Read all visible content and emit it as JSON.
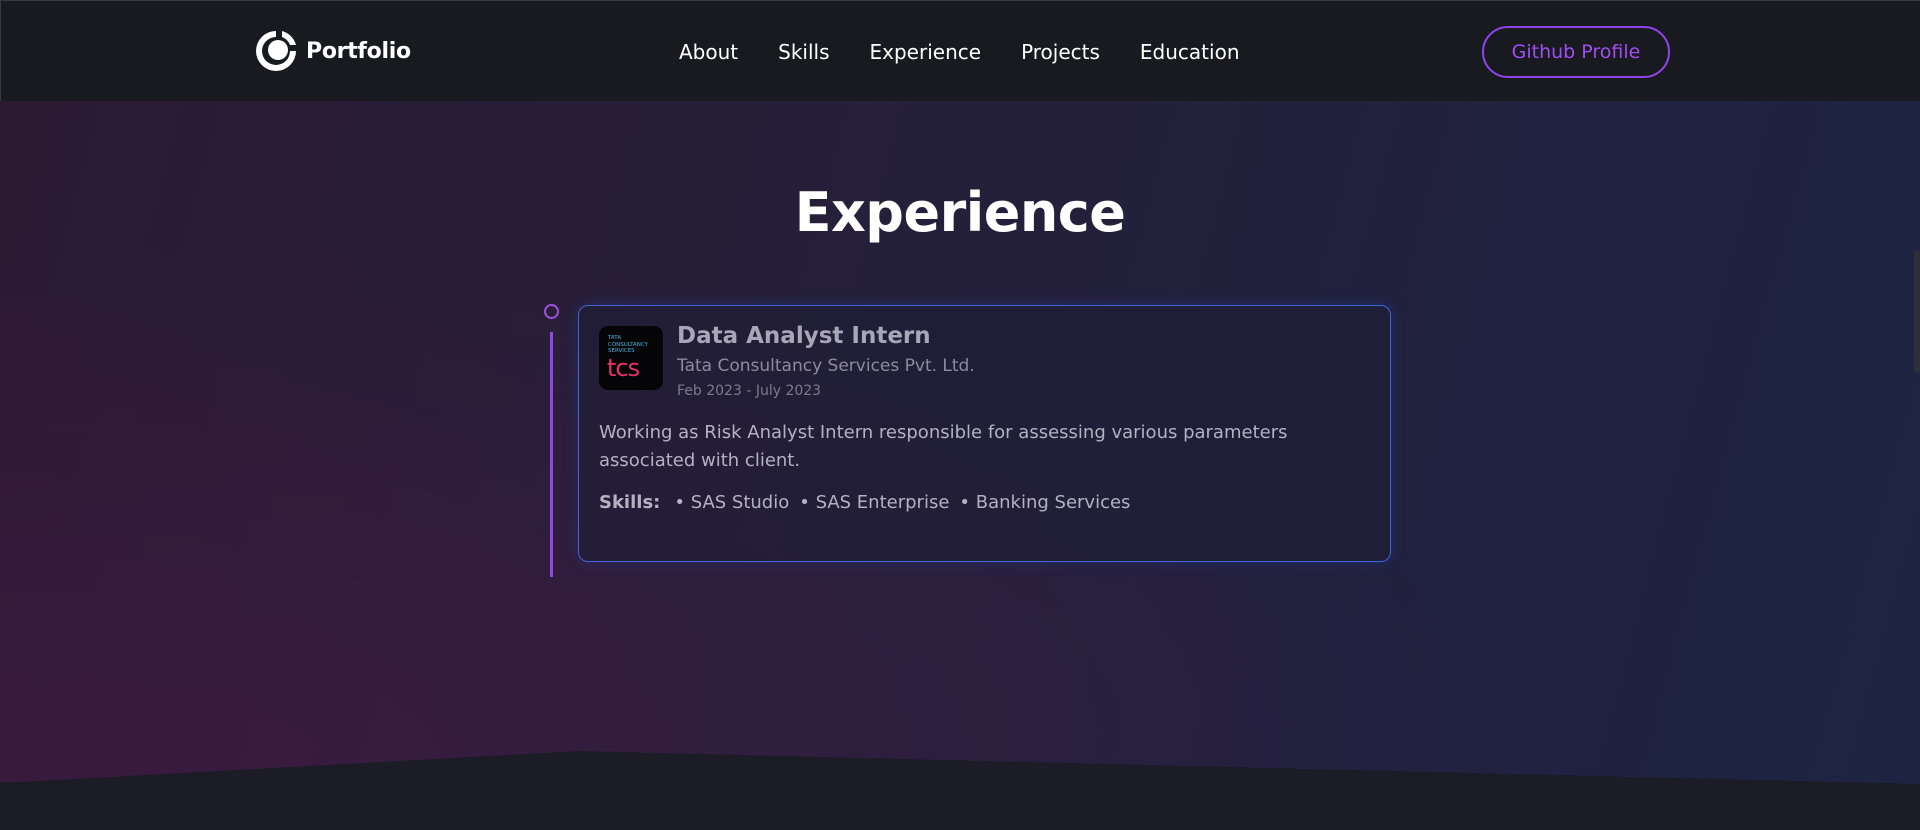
{
  "brand": {
    "name": "Portfolio"
  },
  "nav": {
    "items": [
      {
        "label": "About"
      },
      {
        "label": "Skills"
      },
      {
        "label": "Experience"
      },
      {
        "label": "Projects"
      },
      {
        "label": "Education"
      }
    ]
  },
  "github_button": {
    "label": "Github Profile"
  },
  "section": {
    "title": "Experience"
  },
  "experience": {
    "job_title": "Data Analyst Intern",
    "company": "Tata Consultancy Services Pvt. Ltd.",
    "duration": "Feb 2023 - July 2023",
    "description": "Working as Risk Analyst Intern responsible for assessing various parameters associated with client.",
    "skills_label": "Skills:",
    "skills": [
      "• SAS Studio",
      "• SAS Enterprise",
      "• Banking Services"
    ],
    "logo": {
      "line1": "TATA",
      "line2": "CONSULTANCY",
      "line3": "SERVICES",
      "mark": "tcs"
    }
  },
  "colors": {
    "accent_purple": "#8e44e8",
    "card_border": "#3d66d6",
    "nav_bg": "#191920"
  }
}
